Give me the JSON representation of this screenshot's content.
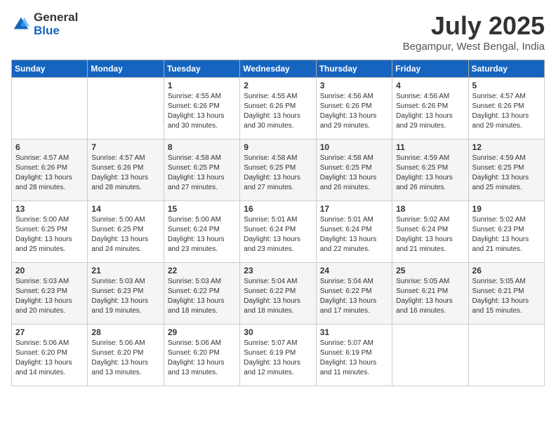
{
  "logo": {
    "general": "General",
    "blue": "Blue"
  },
  "title": "July 2025",
  "location": "Begampur, West Bengal, India",
  "days_of_week": [
    "Sunday",
    "Monday",
    "Tuesday",
    "Wednesday",
    "Thursday",
    "Friday",
    "Saturday"
  ],
  "weeks": [
    [
      {
        "day": "",
        "text": ""
      },
      {
        "day": "",
        "text": ""
      },
      {
        "day": "1",
        "text": "Sunrise: 4:55 AM\nSunset: 6:26 PM\nDaylight: 13 hours and 30 minutes."
      },
      {
        "day": "2",
        "text": "Sunrise: 4:55 AM\nSunset: 6:26 PM\nDaylight: 13 hours and 30 minutes."
      },
      {
        "day": "3",
        "text": "Sunrise: 4:56 AM\nSunset: 6:26 PM\nDaylight: 13 hours and 29 minutes."
      },
      {
        "day": "4",
        "text": "Sunrise: 4:56 AM\nSunset: 6:26 PM\nDaylight: 13 hours and 29 minutes."
      },
      {
        "day": "5",
        "text": "Sunrise: 4:57 AM\nSunset: 6:26 PM\nDaylight: 13 hours and 29 minutes."
      }
    ],
    [
      {
        "day": "6",
        "text": "Sunrise: 4:57 AM\nSunset: 6:26 PM\nDaylight: 13 hours and 28 minutes."
      },
      {
        "day": "7",
        "text": "Sunrise: 4:57 AM\nSunset: 6:26 PM\nDaylight: 13 hours and 28 minutes."
      },
      {
        "day": "8",
        "text": "Sunrise: 4:58 AM\nSunset: 6:25 PM\nDaylight: 13 hours and 27 minutes."
      },
      {
        "day": "9",
        "text": "Sunrise: 4:58 AM\nSunset: 6:25 PM\nDaylight: 13 hours and 27 minutes."
      },
      {
        "day": "10",
        "text": "Sunrise: 4:58 AM\nSunset: 6:25 PM\nDaylight: 13 hours and 26 minutes."
      },
      {
        "day": "11",
        "text": "Sunrise: 4:59 AM\nSunset: 6:25 PM\nDaylight: 13 hours and 26 minutes."
      },
      {
        "day": "12",
        "text": "Sunrise: 4:59 AM\nSunset: 6:25 PM\nDaylight: 13 hours and 25 minutes."
      }
    ],
    [
      {
        "day": "13",
        "text": "Sunrise: 5:00 AM\nSunset: 6:25 PM\nDaylight: 13 hours and 25 minutes."
      },
      {
        "day": "14",
        "text": "Sunrise: 5:00 AM\nSunset: 6:25 PM\nDaylight: 13 hours and 24 minutes."
      },
      {
        "day": "15",
        "text": "Sunrise: 5:00 AM\nSunset: 6:24 PM\nDaylight: 13 hours and 23 minutes."
      },
      {
        "day": "16",
        "text": "Sunrise: 5:01 AM\nSunset: 6:24 PM\nDaylight: 13 hours and 23 minutes."
      },
      {
        "day": "17",
        "text": "Sunrise: 5:01 AM\nSunset: 6:24 PM\nDaylight: 13 hours and 22 minutes."
      },
      {
        "day": "18",
        "text": "Sunrise: 5:02 AM\nSunset: 6:24 PM\nDaylight: 13 hours and 21 minutes."
      },
      {
        "day": "19",
        "text": "Sunrise: 5:02 AM\nSunset: 6:23 PM\nDaylight: 13 hours and 21 minutes."
      }
    ],
    [
      {
        "day": "20",
        "text": "Sunrise: 5:03 AM\nSunset: 6:23 PM\nDaylight: 13 hours and 20 minutes."
      },
      {
        "day": "21",
        "text": "Sunrise: 5:03 AM\nSunset: 6:23 PM\nDaylight: 13 hours and 19 minutes."
      },
      {
        "day": "22",
        "text": "Sunrise: 5:03 AM\nSunset: 6:22 PM\nDaylight: 13 hours and 18 minutes."
      },
      {
        "day": "23",
        "text": "Sunrise: 5:04 AM\nSunset: 6:22 PM\nDaylight: 13 hours and 18 minutes."
      },
      {
        "day": "24",
        "text": "Sunrise: 5:04 AM\nSunset: 6:22 PM\nDaylight: 13 hours and 17 minutes."
      },
      {
        "day": "25",
        "text": "Sunrise: 5:05 AM\nSunset: 6:21 PM\nDaylight: 13 hours and 16 minutes."
      },
      {
        "day": "26",
        "text": "Sunrise: 5:05 AM\nSunset: 6:21 PM\nDaylight: 13 hours and 15 minutes."
      }
    ],
    [
      {
        "day": "27",
        "text": "Sunrise: 5:06 AM\nSunset: 6:20 PM\nDaylight: 13 hours and 14 minutes."
      },
      {
        "day": "28",
        "text": "Sunrise: 5:06 AM\nSunset: 6:20 PM\nDaylight: 13 hours and 13 minutes."
      },
      {
        "day": "29",
        "text": "Sunrise: 5:06 AM\nSunset: 6:20 PM\nDaylight: 13 hours and 13 minutes."
      },
      {
        "day": "30",
        "text": "Sunrise: 5:07 AM\nSunset: 6:19 PM\nDaylight: 13 hours and 12 minutes."
      },
      {
        "day": "31",
        "text": "Sunrise: 5:07 AM\nSunset: 6:19 PM\nDaylight: 13 hours and 11 minutes."
      },
      {
        "day": "",
        "text": ""
      },
      {
        "day": "",
        "text": ""
      }
    ]
  ]
}
